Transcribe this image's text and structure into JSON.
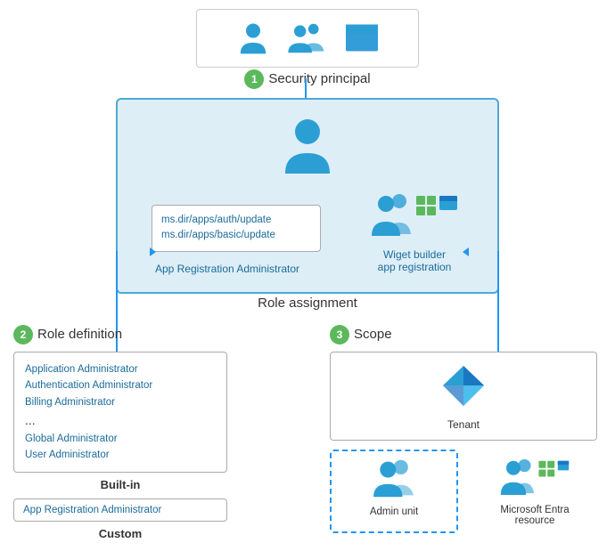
{
  "security_principal": {
    "label": "Security principal",
    "badge": "1"
  },
  "role_assignment": {
    "label": "Role assignment"
  },
  "app_reg_box": {
    "line1": "ms.dir/apps/auth/update",
    "line2": "ms.dir/apps/basic/update"
  },
  "app_reg_label": "App Registration Administrator",
  "wiget": {
    "label": "Wiget builder\napp registration"
  },
  "role_definition": {
    "badge": "2",
    "title": "Role definition",
    "roles": [
      "Application Administrator",
      "Authentication Administrator",
      "Billing Administrator",
      "...",
      "Global Administrator",
      "User Administrator"
    ],
    "builtin_label": "Built-in",
    "custom_role": "App Registration Administrator",
    "custom_label": "Custom"
  },
  "scope": {
    "badge": "3",
    "title": "Scope",
    "tenant_label": "Tenant",
    "admin_unit_label": "Admin unit",
    "ms_entra_label": "Microsoft Entra\nresource"
  }
}
